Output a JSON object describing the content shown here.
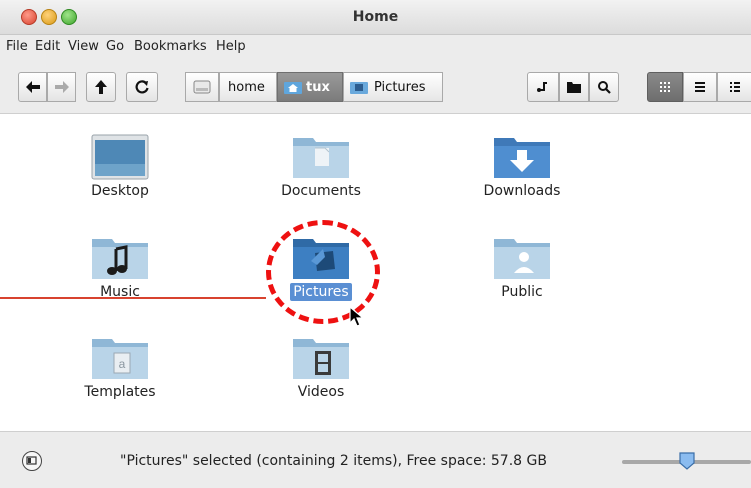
{
  "window": {
    "title": "Home"
  },
  "menu": [
    "File",
    "Edit",
    "View",
    "Go",
    "Bookmarks",
    "Help"
  ],
  "toolbar": {
    "breadcrumbs": [
      {
        "label": "home",
        "active": false
      },
      {
        "label": "tux",
        "active": true
      },
      {
        "label": "Pictures",
        "active": false
      }
    ],
    "icons": [
      "back-arrow-icon",
      "forward-arrow-icon",
      "up-arrow-icon",
      "reload-icon",
      "drive-icon",
      "open-terminal-icon",
      "new-folder-icon",
      "search-icon",
      "icon-view-icon",
      "list-view-icon",
      "compact-view-icon"
    ]
  },
  "files": [
    {
      "name": "Desktop",
      "icon": "desktop-folder-icon"
    },
    {
      "name": "Documents",
      "icon": "documents-folder-icon"
    },
    {
      "name": "Downloads",
      "icon": "downloads-folder-icon"
    },
    {
      "name": "Music",
      "icon": "music-folder-icon"
    },
    {
      "name": "Pictures",
      "icon": "pictures-folder-icon",
      "selected": true
    },
    {
      "name": "Public",
      "icon": "public-folder-icon"
    },
    {
      "name": "Templates",
      "icon": "templates-folder-icon"
    },
    {
      "name": "Videos",
      "icon": "videos-folder-icon"
    }
  ],
  "statusbar": {
    "text": "\"Pictures\" selected (containing 2 items), Free space: 57.8 GB",
    "zoom_level": 0.45
  },
  "colors": {
    "selection": "#5a8fd3",
    "annotation": "#ee1111"
  }
}
